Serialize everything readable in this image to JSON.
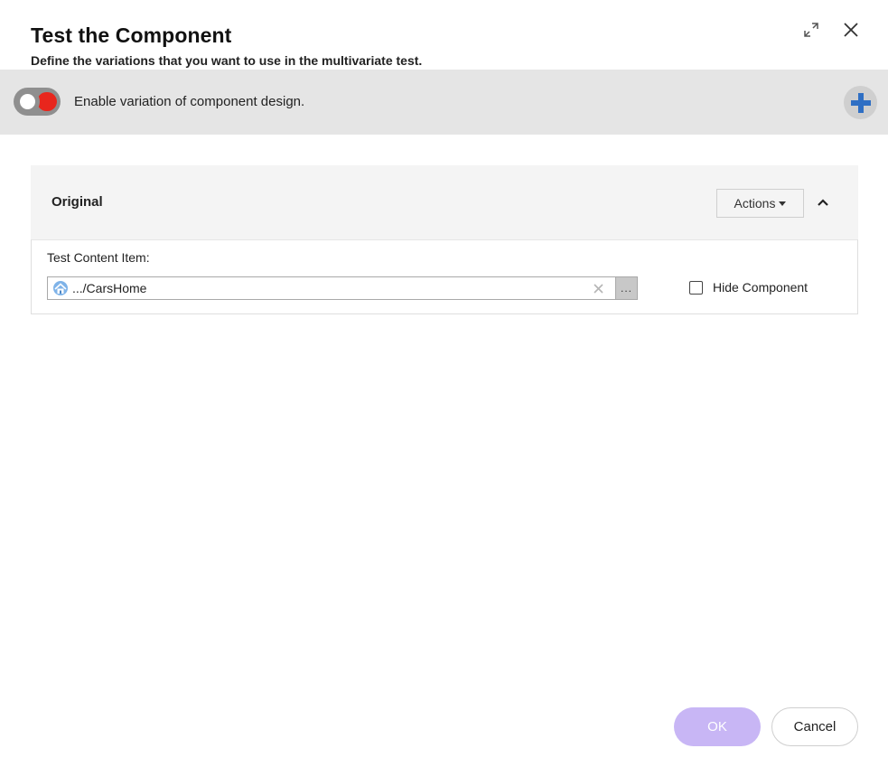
{
  "dialog": {
    "title": "Test the Component",
    "subtitle": "Define the variations that you want to use in the multivariate test.",
    "controls": {
      "maximize_icon": "expand-arrows-icon",
      "close_icon": "close-icon"
    }
  },
  "toggle_band": {
    "label": "Enable variation of component design.",
    "toggle_state": "off",
    "add_icon": "plus-icon"
  },
  "variation": {
    "title": "Original",
    "actions_label": "Actions",
    "collapse_icon": "chevron-up-icon",
    "field_label": "Test Content Item:",
    "content_item_value": ".../CarsHome",
    "item_icon": "home-page-icon",
    "clear_icon": "clear-x-icon",
    "browse_label": "...",
    "hide_component_label": "Hide Component",
    "hide_component_checked": false
  },
  "footer": {
    "ok_label": "OK",
    "cancel_label": "Cancel"
  },
  "colors": {
    "band_bg": "#e5e5e5",
    "toggle_red": "#e8261d",
    "plus_blue": "#2f6fc4",
    "ok_disabled": "#c8b6f5"
  }
}
